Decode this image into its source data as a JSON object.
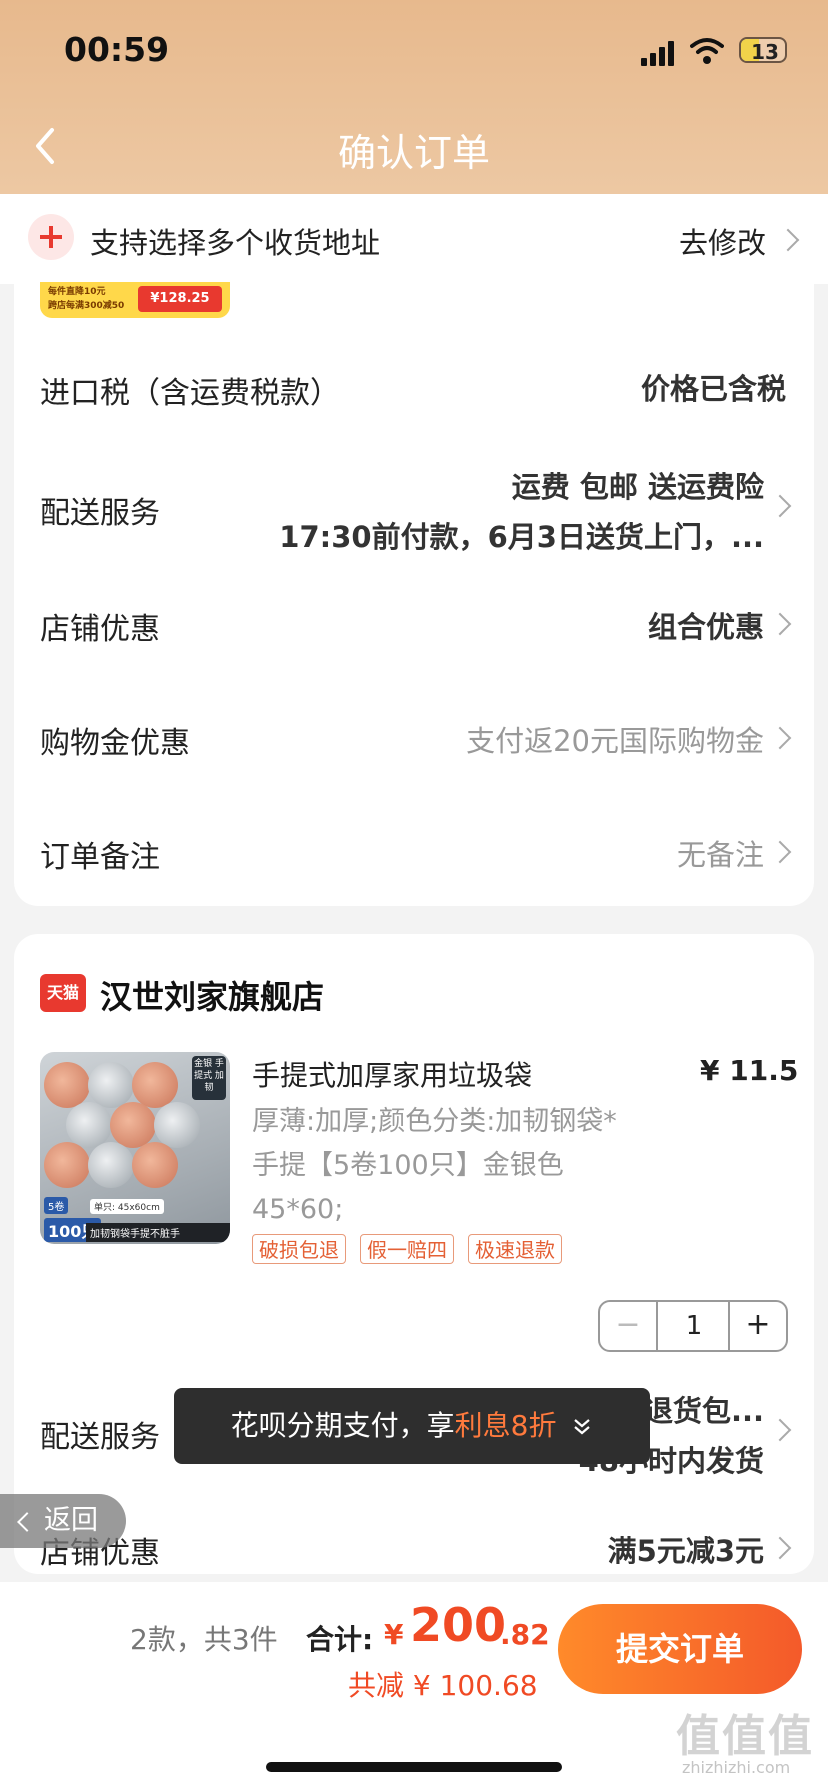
{
  "status_bar": {
    "time": "00:59",
    "battery": "13"
  },
  "nav": {
    "title": "确认订单"
  },
  "address": {
    "text": "支持选择多个收货地址",
    "modify": "去修改"
  },
  "promo_banner": {
    "line1": "每件直降10元",
    "line2": "跨店每满300减50",
    "price": "¥128.25"
  },
  "order1": {
    "rows": [
      {
        "label": "进口税（含运费税款）",
        "value": "价格已含税"
      },
      {
        "label": "配送服务",
        "value": "运费 包邮 送运费险",
        "value2": "17:30前付款，6月3日送货上门，..."
      },
      {
        "label": "店铺优惠",
        "value": "组合优惠"
      },
      {
        "label": "购物金优惠",
        "value": "支付返20元国际购物金"
      },
      {
        "label": "订单备注",
        "value": "无备注"
      }
    ]
  },
  "shop": {
    "badge": "天猫",
    "name": "汉世刘家旗舰店",
    "product": {
      "title": "手提式加厚家用垃圾袋",
      "price": "¥ 11.5",
      "specs": "厚薄:加厚;颜色分类:加韧钢袋*手提【5卷100只】金银色 45*60;",
      "img_badge": "金银 手提式 加韧",
      "img_count": "5卷",
      "img_100": "100只",
      "img_size": "单只: 45x60cm",
      "img_caption": "加韧钢袋手提不脏手",
      "tags": [
        "破损包退",
        "假一赔四",
        "极速退款"
      ],
      "quantity": "1"
    },
    "rows": [
      {
        "label": "配送服务",
        "value": "退货包...",
        "value2": "48小时内发货"
      },
      {
        "label": "店铺优惠",
        "value": "满5元减3元"
      }
    ]
  },
  "toast": {
    "prefix": "花呗分期支付，享",
    "highlight": "利息8折"
  },
  "float_back": {
    "label": "返回"
  },
  "footer": {
    "count": "2款，共3件",
    "total_label": "合计:",
    "yen": "¥",
    "total_int": "200",
    "total_dec": ".82",
    "discount": "共减 ¥ 100.68",
    "submit": "提交订单"
  },
  "watermark": {
    "main": "值值值",
    "sub": "zhizhizhi.com"
  },
  "colors": {
    "accent": "#f04a24",
    "header_bg": "#e7b98d",
    "tmall_red": "#e8392f"
  }
}
